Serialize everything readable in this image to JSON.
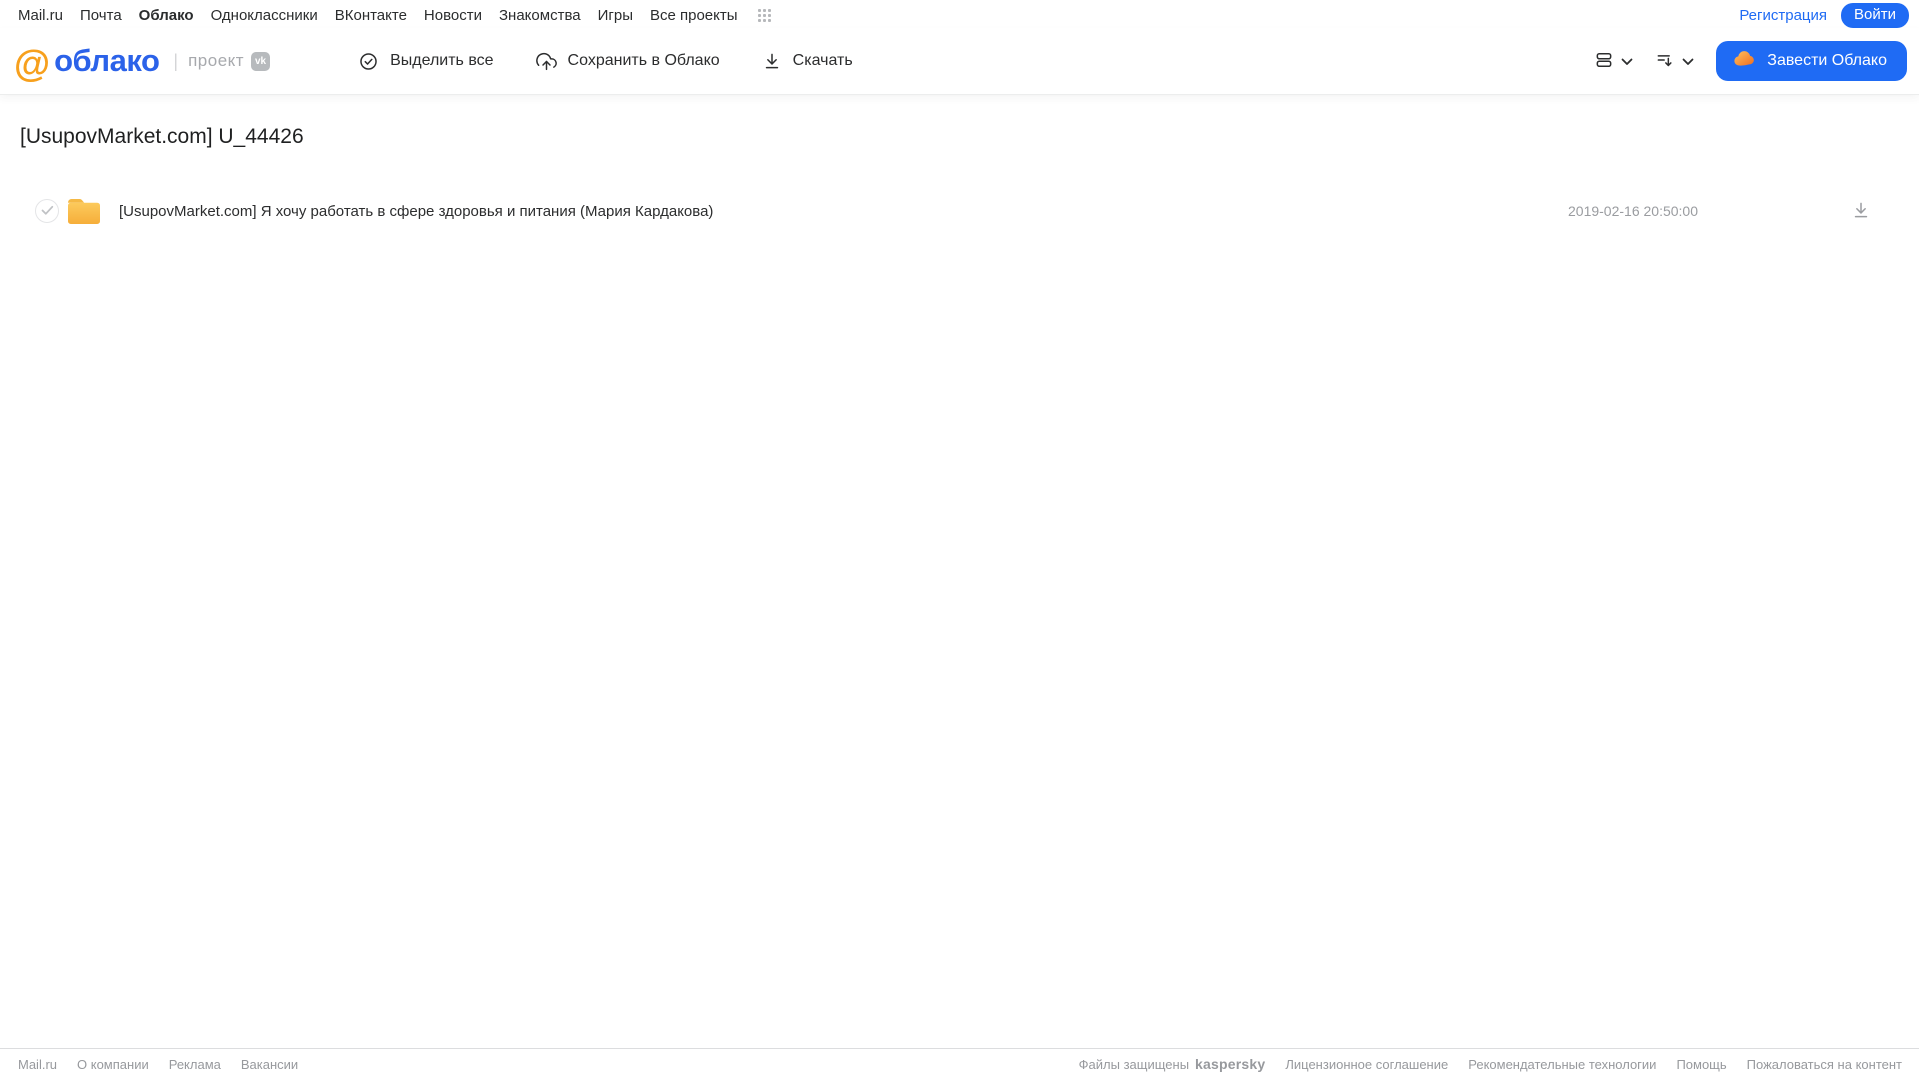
{
  "topnav": {
    "items": [
      "Mail.ru",
      "Почта",
      "Облако",
      "Одноклассники",
      "ВКонтакте",
      "Новости",
      "Знакомства",
      "Игры",
      "Все проекты"
    ],
    "register_label": "Регистрация",
    "login_label": "Войти"
  },
  "header": {
    "logo_at": "@",
    "logo_text": "облако",
    "divider": "|",
    "project_label": "проект",
    "project_badge": "vk",
    "toolbar": {
      "select_all": "Выделить все",
      "save_to_cloud": "Сохранить в Облако",
      "download": "Скачать"
    },
    "get_cloud_button": "Завести Облако"
  },
  "main": {
    "title": "[UsupovMarket.com] U_44426",
    "files": [
      {
        "name": "[UsupovMarket.com] Я хочу работать в сфере здоровья и питания (Мария Кардакова)",
        "date": "2019-02-16 20:50:00",
        "type": "folder"
      }
    ]
  },
  "footer": {
    "links_left": [
      "Mail.ru",
      "О компании",
      "Реклама",
      "Вакансии"
    ],
    "protected_text": "Файлы защищены",
    "kaspersky": "kaspersky",
    "links_right": [
      "Лицензионное соглашение",
      "Рекомендательные технологии",
      "Помощь",
      "Пожаловаться на контент"
    ]
  },
  "colors": {
    "accent_blue": "#1f6bf4",
    "logo_blue": "#2b62e9",
    "logo_orange": "#f7a01d",
    "folder_yellow": "#f8c153",
    "kaspersky_teal": "#00997e",
    "icon_dark": "#2c2d2e",
    "muted_gray": "#9a9ca0"
  }
}
